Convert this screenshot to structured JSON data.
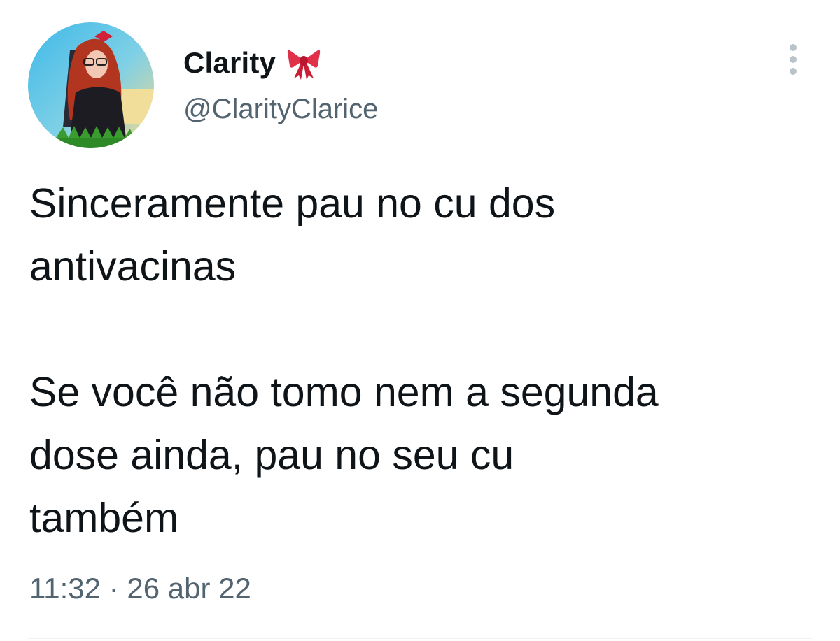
{
  "author": {
    "display_name": "Clarity",
    "name_emoji_icon": "ribbon-bow-icon",
    "handle": "@ClarityClarice",
    "avatar_icon": "profile-photo"
  },
  "tweet": {
    "text": "Sinceramente pau no cu dos\nantivacinas\n\nSe você não tomo nem a segunda\ndose ainda, pau no seu cu\ntambém",
    "time": "11:32",
    "separator": "·",
    "date": "26 abr 22"
  },
  "menu": {
    "icon": "more-options-icon"
  },
  "colors": {
    "text_primary": "#0f1419",
    "text_secondary": "#536471",
    "bow_red": "#e0304a",
    "divider": "#eff3f4"
  }
}
